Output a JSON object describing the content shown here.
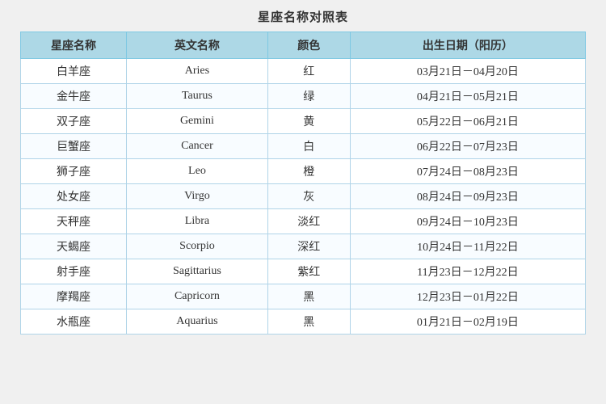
{
  "title": "星座名称对照表",
  "columns": [
    "星座名称",
    "英文名称",
    "颜色",
    "出生日期（阳历）"
  ],
  "rows": [
    {
      "chinese": "白羊座",
      "english": "Aries",
      "color": "红",
      "dates": "03月21日－04月20日"
    },
    {
      "chinese": "金牛座",
      "english": "Taurus",
      "color": "绿",
      "dates": "04月21日－05月21日"
    },
    {
      "chinese": "双子座",
      "english": "Gemini",
      "color": "黄",
      "dates": "05月22日－06月21日"
    },
    {
      "chinese": "巨蟹座",
      "english": "Cancer",
      "color": "白",
      "dates": "06月22日－07月23日"
    },
    {
      "chinese": "狮子座",
      "english": "Leo",
      "color": "橙",
      "dates": "07月24日－08月23日"
    },
    {
      "chinese": "处女座",
      "english": "Virgo",
      "color": "灰",
      "dates": "08月24日－09月23日"
    },
    {
      "chinese": "天秤座",
      "english": "Libra",
      "color": "淡红",
      "dates": "09月24日－10月23日"
    },
    {
      "chinese": "天蝎座",
      "english": "Scorpio",
      "color": "深红",
      "dates": "10月24日－11月22日"
    },
    {
      "chinese": "射手座",
      "english": "Sagittarius",
      "color": "紫红",
      "dates": "11月23日－12月22日"
    },
    {
      "chinese": "摩羯座",
      "english": "Capricorn",
      "color": "黑",
      "dates": "12月23日－01月22日"
    },
    {
      "chinese": "水瓶座",
      "english": "Aquarius",
      "color": "黑",
      "dates": "01月21日－02月19日"
    }
  ]
}
